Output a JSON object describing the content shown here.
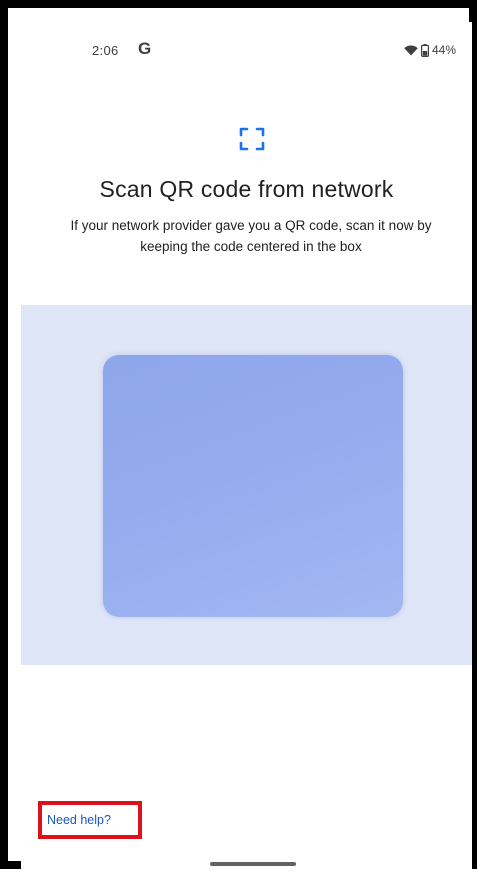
{
  "status_bar": {
    "time": "2:06",
    "google_glyph": "G",
    "wifi_icon": "wifi-icon",
    "battery_icon": "battery-icon",
    "battery_percent": "44%"
  },
  "header": {
    "scan_icon": "qr-scan-frame-icon",
    "title": "Scan QR code from network",
    "description": "If your network provider gave you a QR code, scan it now by keeping the code centered in the box"
  },
  "help": {
    "link_label": "Need help?",
    "highlight_color": "#e0101a"
  },
  "colors": {
    "accent": "#1a73e8",
    "link": "#1a57c4",
    "viewfinder_background": "#dfe6f7",
    "scan_box": "#94abee"
  }
}
